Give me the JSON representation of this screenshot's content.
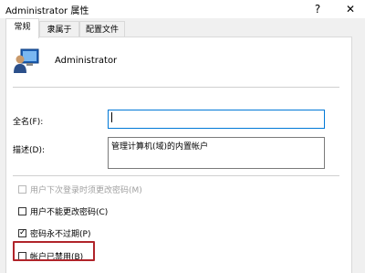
{
  "window": {
    "title": "Administrator 属性",
    "help_glyph": "?",
    "close_glyph": "✕"
  },
  "tabs": [
    {
      "label": "常规",
      "active": true
    },
    {
      "label": "隶属于",
      "active": false
    },
    {
      "label": "配置文件",
      "active": false
    }
  ],
  "user": {
    "name": "Administrator"
  },
  "fields": {
    "fullname": {
      "label": "全名(F):",
      "value": ""
    },
    "description": {
      "label": "描述(D):",
      "value": "管理计算机(域)的内置帐户"
    }
  },
  "checkboxes": [
    {
      "label": "用户下次登录时须更改密码(M)",
      "checked": false,
      "enabled": false
    },
    {
      "label": "用户不能更改密码(C)",
      "checked": false,
      "enabled": true
    },
    {
      "label": "密码永不过期(P)",
      "checked": true,
      "enabled": true
    },
    {
      "label": "帐户已禁用(B)",
      "checked": false,
      "enabled": true
    }
  ],
  "colors": {
    "highlight": "#b0242a",
    "focus_border": "#0078d7"
  }
}
